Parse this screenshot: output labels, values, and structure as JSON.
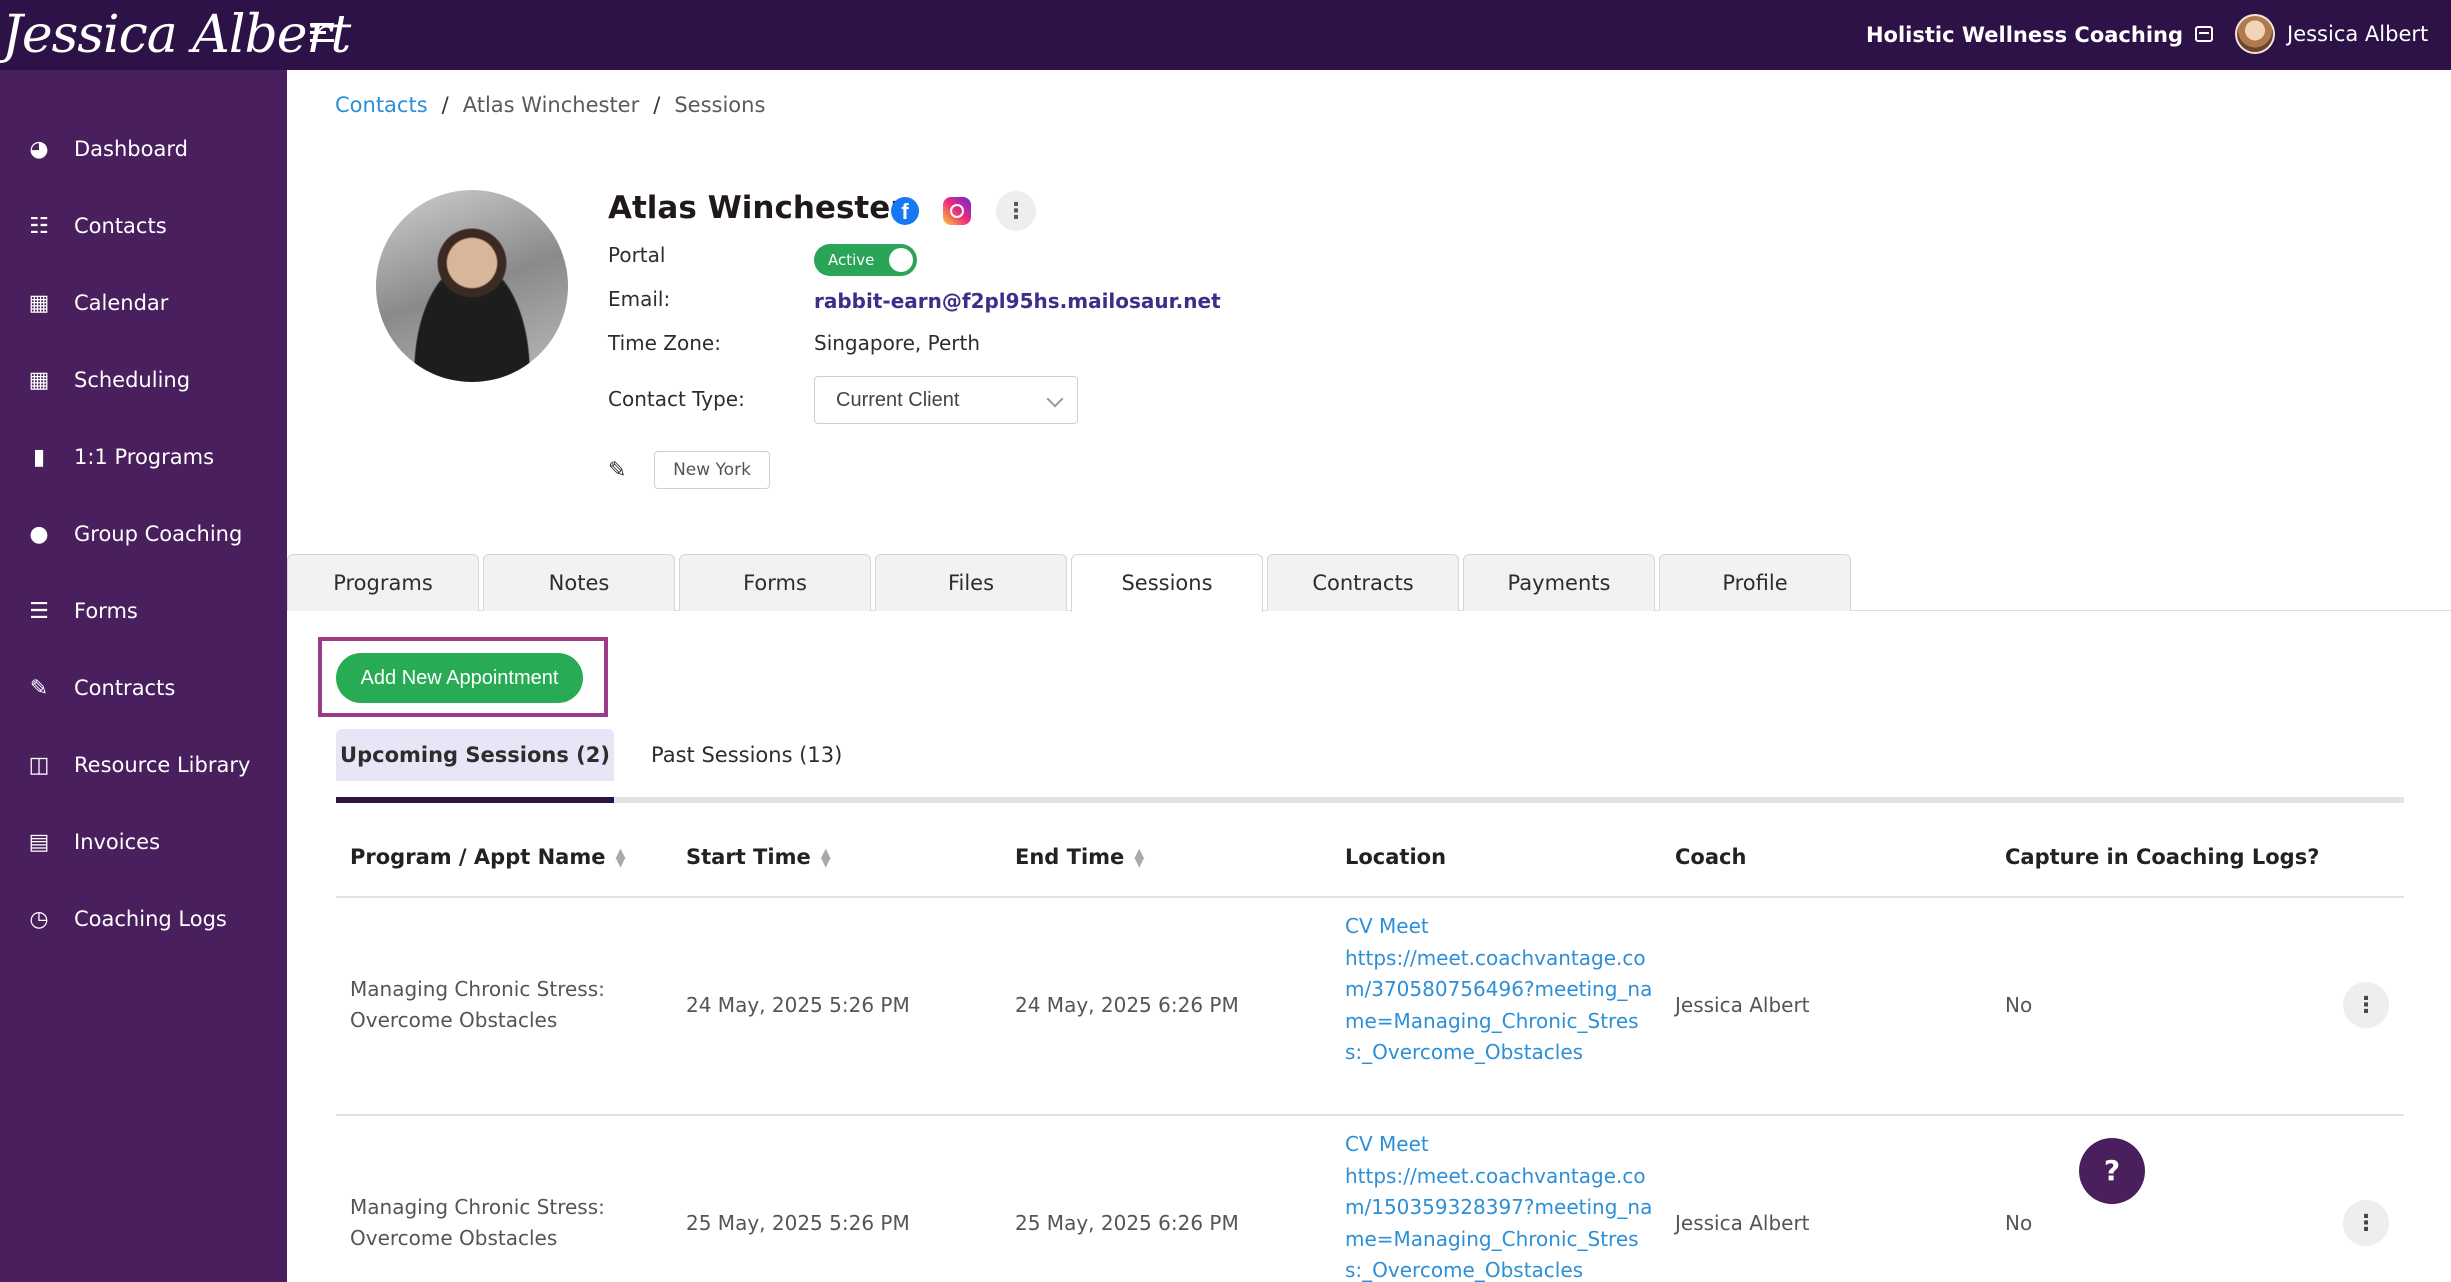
{
  "header": {
    "logo_text": "Jessica Albert",
    "business_name": "Holistic Wellness Coaching",
    "user_name": "Jessica Albert"
  },
  "sidebar": {
    "items": [
      {
        "label": "Dashboard",
        "icon": "dashboard-icon"
      },
      {
        "label": "Contacts",
        "icon": "contacts-icon"
      },
      {
        "label": "Calendar",
        "icon": "calendar-icon"
      },
      {
        "label": "Scheduling",
        "icon": "scheduling-icon"
      },
      {
        "label": "1:1 Programs",
        "icon": "book-icon"
      },
      {
        "label": "Group Coaching",
        "icon": "group-icon"
      },
      {
        "label": "Forms",
        "icon": "forms-icon"
      },
      {
        "label": "Contracts",
        "icon": "contracts-icon"
      },
      {
        "label": "Resource Library",
        "icon": "library-icon"
      },
      {
        "label": "Invoices",
        "icon": "invoice-icon"
      },
      {
        "label": "Coaching Logs",
        "icon": "clock-icon"
      }
    ]
  },
  "breadcrumb": {
    "root": "Contacts",
    "contact": "Atlas Winchester",
    "current": "Sessions",
    "separator": "/"
  },
  "profile": {
    "name": "Atlas Winchester",
    "portal_label": "Portal",
    "portal_status": "Active",
    "email_label": "Email:",
    "email": "rabbit-earn@f2pl95hs.mailosaur.net",
    "timezone_label": "Time Zone:",
    "timezone": "Singapore, Perth",
    "contact_type_label": "Contact Type:",
    "contact_type": "Current Client",
    "tag": "New York"
  },
  "tabs": [
    "Programs",
    "Notes",
    "Forms",
    "Files",
    "Sessions",
    "Contracts",
    "Payments",
    "Profile"
  ],
  "active_tab": "Sessions",
  "sessions": {
    "add_button": "Add New Appointment",
    "upcoming_label": "Upcoming Sessions (2)",
    "past_label": "Past Sessions (13)"
  },
  "table": {
    "headers": {
      "program": "Program / Appt Name",
      "start": "Start Time",
      "end": "End Time",
      "location": "Location",
      "coach": "Coach",
      "capture": "Capture in Coaching Logs?"
    },
    "rows": [
      {
        "program_line1": "Managing Chronic Stress:",
        "program_line2": "Overcome Obstacles",
        "start": "24 May, 2025 5:26 PM",
        "end": "24 May, 2025 6:26 PM",
        "location_title": "CV Meet",
        "location_url": "https://meet.coachvantage.com/370580756496?meeting_name=Managing_Chronic_Stress:_Overcome_Obstacles",
        "coach": "Jessica Albert",
        "capture": "No"
      },
      {
        "program_line1": "Managing Chronic Stress:",
        "program_line2": "Overcome Obstacles",
        "start": "25 May, 2025 5:26 PM",
        "end": "25 May, 2025 6:26 PM",
        "location_title": "CV Meet",
        "location_url": "https://meet.coachvantage.com/150359328397?meeting_name=Managing_Chronic_Stress:_Overcome_Obstacles",
        "coach": "Jessica Albert",
        "capture": "No"
      }
    ]
  },
  "help_label": "?",
  "colors": {
    "topbar": "#2c1247",
    "sidebar": "#4a1f5e",
    "accent_green": "#27ac55",
    "link_blue": "#2d8fd6",
    "highlight": "#9b3a86"
  }
}
